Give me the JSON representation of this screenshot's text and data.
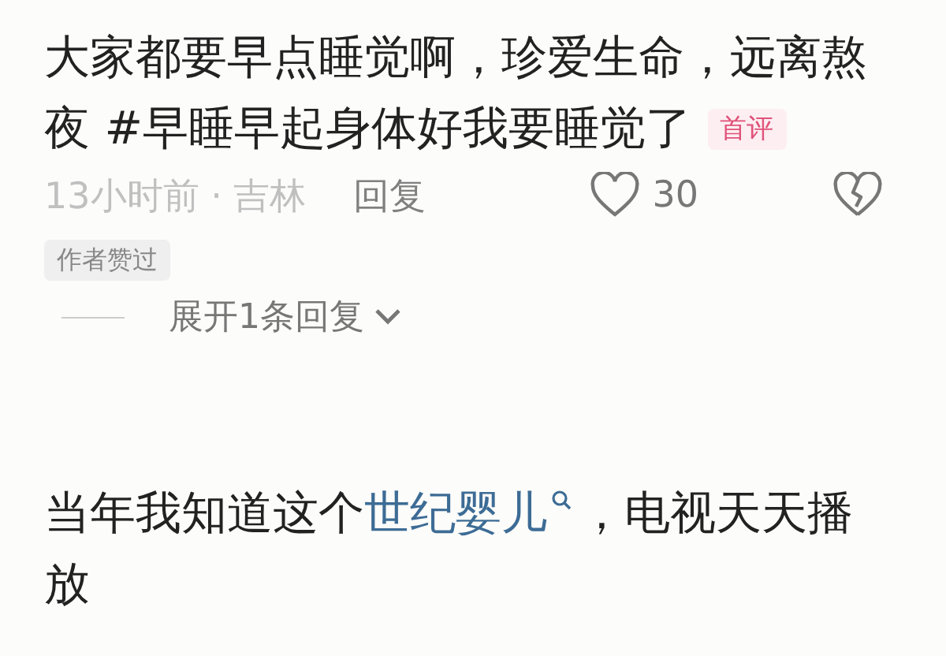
{
  "comments": [
    {
      "parts": [
        {
          "kind": "text",
          "text": "大家都要早点睡觉啊，珍爱生命，远离熬夜 #早睡早起身体好我要睡觉了"
        }
      ],
      "badge": "首评",
      "time": "13小时前 · 吉林",
      "reply": "回复",
      "likes": "30",
      "author_liked": "作者赞过",
      "expand": "展开1条回复"
    },
    {
      "parts": [
        {
          "kind": "text",
          "text": "当年我知道这个"
        },
        {
          "kind": "link",
          "text": "世纪婴儿"
        },
        {
          "kind": "text",
          "text": "，电视天天播放"
        }
      ]
    }
  ]
}
